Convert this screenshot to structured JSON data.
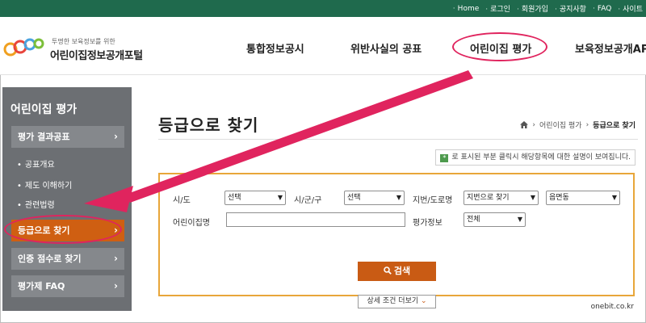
{
  "utility_nav": [
    "Home",
    "로그인",
    "회원가입",
    "공지사항",
    "FAQ",
    "사이트"
  ],
  "logo": {
    "tagline": "투명한 보육정보를 위한",
    "title": "어린이집정보공개포털"
  },
  "gnb": [
    "통합정보공시",
    "위반사실의 공표",
    "어린이집 평가",
    "보육정보공개AP"
  ],
  "sidebar": {
    "title": "어린이집 평가",
    "menu": [
      {
        "label": "평가 결과공표",
        "state": "normal"
      },
      {
        "label": "공표개요",
        "state": "sub"
      },
      {
        "label": "제도 이해하기",
        "state": "sub"
      },
      {
        "label": "관련법령",
        "state": "sub"
      },
      {
        "label": "등급으로 찾기",
        "state": "active"
      },
      {
        "label": "인증 점수로 찾기",
        "state": "normal"
      },
      {
        "label": "평가제 FAQ",
        "state": "normal"
      }
    ]
  },
  "page": {
    "title": "등급으로 찾기",
    "breadcrumb": [
      "어린이집 평가",
      "등급으로 찾기"
    ]
  },
  "info_note": "로 표시된 부분 클릭시 해당항목에 대한 설명이 보여집니다.",
  "search_form": {
    "sido_label": "시/도",
    "sido_value": "선택",
    "sigungu_label": "시/군/구",
    "sigungu_value": "선택",
    "address_label": "지번/도로명",
    "address_type_value": "지번으로 찾기",
    "dong_value": "읍면동",
    "name_label": "어린이집명",
    "name_value": "",
    "eval_label": "평가정보",
    "eval_value": "전체",
    "search_label": "검색",
    "more_label": "상세 조건 더보기"
  },
  "watermark": "onebit.co.kr",
  "colors": {
    "topbar": "#1f6a4d",
    "sidebar": "#6c6f73",
    "active": "#cf5f12",
    "accent": "#e0245e",
    "search_border": "#e8a63a"
  },
  "icons": [
    "home-icon",
    "chevron-right-icon",
    "search-icon",
    "chevron-down-icon",
    "help-icon"
  ]
}
